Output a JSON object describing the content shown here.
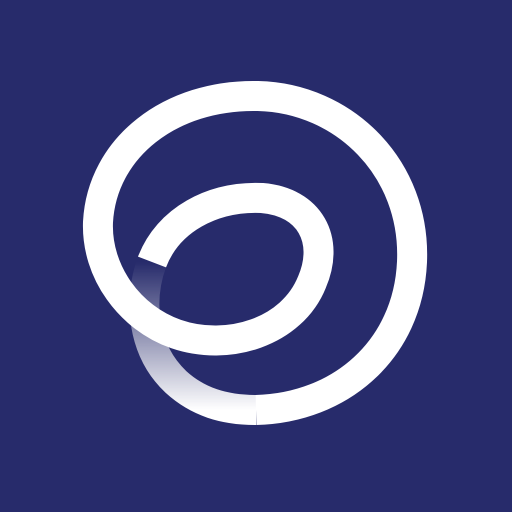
{
  "icon": {
    "name": "spiral-loop-logo",
    "colors": {
      "background": "#272B6B",
      "stroke": "#FFFFFF"
    }
  }
}
